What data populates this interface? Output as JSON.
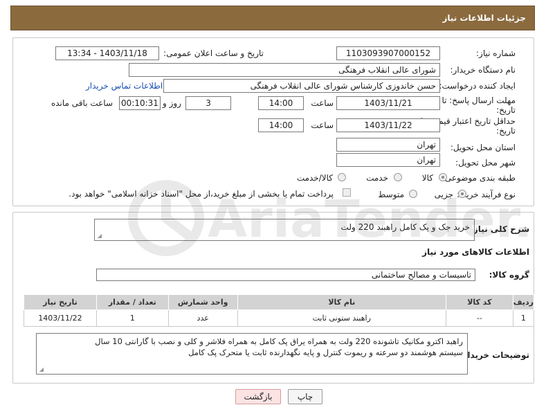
{
  "header": {
    "title": "جزئیات اطلاعات نیاز"
  },
  "form": {
    "need_number_label": "شماره نیاز:",
    "need_number": "1103093907000152",
    "announce_label": "تاریخ و ساعت اعلان عمومی:",
    "announce_value": "1403/11/18 - 13:34",
    "buyer_org_label": "نام دستگاه خریدار:",
    "buyer_org": "شورای عالی انقلاب فرهنگی",
    "creator_label": "ایجاد کننده درخواست:",
    "creator": "حسن خاندوزی کارشناس شورای عالی انقلاب فرهنگی",
    "contact_link": "اطلاعات تماس خریدار",
    "deadline_label_1": "مهلت ارسال پاسخ: تا",
    "deadline_label_2": "تاریخ:",
    "deadline_date": "1403/11/21",
    "time_label": "ساعت",
    "deadline_time": "14:00",
    "days_value": "3",
    "days_label": "روز و",
    "remaining_time": "00:10:31",
    "remaining_label": "ساعت باقی مانده",
    "min_validity_label_1": "حداقل تاریخ اعتبار قیمت: تا",
    "min_validity_label_2": "تاریخ:",
    "validity_date": "1403/11/22",
    "validity_time_label": "ساعت",
    "validity_time": "14:00",
    "province_label": "استان محل تحویل:",
    "province": "تهران",
    "city_label": "شهر محل تحویل:",
    "city": "تهران",
    "category_label": "طبقه بندی موضوعی:",
    "category_options": [
      "کالا",
      "خدمت",
      "کالا/خدمت"
    ],
    "category_selected": "کالا",
    "process_label": "نوع فرآیند خرید :",
    "process_options": [
      "جزیی",
      "متوسط"
    ],
    "process_selected": "جزیی",
    "payment_note": "پرداخت تمام یا بخشی از مبلغ خرید،از محل \"اسناد خزانه اسلامی\" خواهد بود."
  },
  "details": {
    "summary_label": "شرح کلی نیاز:",
    "summary": "خرید جک و پک کامل راهبند 220 ولت",
    "goods_info_title": "اطلاعات کالاهای مورد نیاز",
    "group_label": "گروه کالا:",
    "group_value": "تاسیسات و مصالح ساختمانی",
    "table": {
      "headers": [
        "ردیف",
        "کد کالا",
        "نام کالا",
        "واحد شمارش",
        "تعداد / مقدار",
        "تاریخ نیاز"
      ],
      "rows": [
        [
          "1",
          "--",
          "راهبند ستونی ثابت",
          "عدد",
          "1",
          "1403/11/22"
        ]
      ]
    },
    "buyer_desc_label": "توضیحات خریدار:",
    "buyer_desc_line1": "راهبد  اکترو مکانیک تاشونده 220 ولت  به همراه یراق پک کامل به همراه فلاشر و کلی و نصب با گارانتی 10 سال",
    "buyer_desc_line2": "سیستم هوشمند دو سرعته و ریموت کنترل و پایه نگهدارنده ثابت یا متحرک پک کامل"
  },
  "buttons": {
    "print": "چاپ",
    "back": "بازگشت"
  },
  "watermark_text": "AriaTender.neT",
  "colors": {
    "header_bg": "#8b6a3e",
    "link": "#1a4fb5",
    "back_button": "#fbe3e3"
  }
}
